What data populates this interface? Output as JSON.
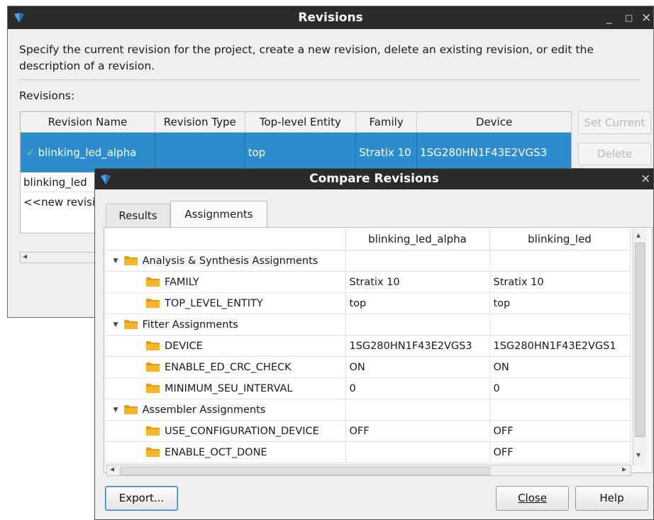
{
  "revisions_window": {
    "title": "Revisions",
    "minimize_glyph": "_",
    "maximize_glyph": "□",
    "close_glyph": "×",
    "description": "Specify the current revision for the project, create a new revision, delete an existing revision, or edit the description of a revision.",
    "table_label": "Revisions:",
    "columns": [
      "Revision Name",
      "Revision Type",
      "Top-level Entity",
      "Family",
      "Device"
    ],
    "selected_row": {
      "check_glyph": "✓",
      "name": "blinking_led_alpha",
      "type": "",
      "entity": "top",
      "family": "Stratix 10",
      "device": "1SG280HN1F43E2VGS3"
    },
    "rows": [
      "blinking_led",
      "<<new revisi"
    ],
    "set_current_label": "Set Current",
    "delete_label": "Delete",
    "scroll_left_glyph": "◂"
  },
  "compare_window": {
    "title": "Compare Revisions",
    "close_glyph": "×",
    "tabs": [
      "Results",
      "Assignments"
    ],
    "active_tab": "Assignments",
    "columns": [
      "",
      "blinking_led_alpha",
      "blinking_led"
    ],
    "groups": [
      {
        "label": "Analysis & Synthesis Assignments",
        "items": [
          {
            "name": "FAMILY",
            "alpha": "Stratix 10",
            "led": "Stratix 10"
          },
          {
            "name": "TOP_LEVEL_ENTITY",
            "alpha": "top",
            "led": "top"
          }
        ]
      },
      {
        "label": "Fitter Assignments",
        "items": [
          {
            "name": "DEVICE",
            "alpha": "1SG280HN1F43E2VGS3",
            "led": "1SG280HN1F43E2VGS1"
          },
          {
            "name": "ENABLE_ED_CRC_CHECK",
            "alpha": "ON",
            "led": "ON"
          },
          {
            "name": "MINIMUM_SEU_INTERVAL",
            "alpha": "0",
            "led": "0"
          }
        ]
      },
      {
        "label": "Assembler Assignments",
        "items": [
          {
            "name": "USE_CONFIGURATION_DEVICE",
            "alpha": "OFF",
            "led": "OFF"
          },
          {
            "name": "ENABLE_OCT_DONE",
            "alpha": "",
            "led": "OFF"
          }
        ]
      }
    ],
    "expand_glyph": "▼",
    "scroll_up_glyph": "▴",
    "scroll_down_glyph": "▾",
    "scroll_left_glyph": "◂",
    "scroll_right_glyph": "▸",
    "export_label": "Export...",
    "close_label": "Close",
    "help_label": "Help"
  },
  "colors": {
    "titlebar": "#2b2b2b",
    "selection": "#2c8ccc",
    "folder": "#f0a81c",
    "check": "#7fd06b"
  }
}
